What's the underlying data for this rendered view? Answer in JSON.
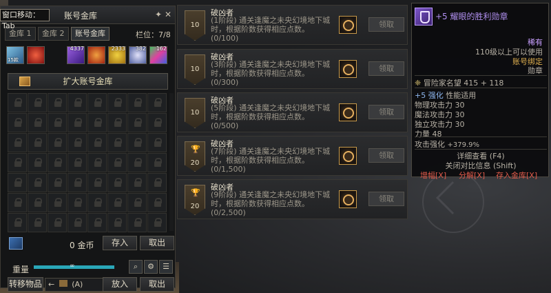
{
  "vault": {
    "title": "账号金库",
    "move_hint": "窗口移动：Tab",
    "tabs": [
      "金库 1",
      "金库 2",
      "账号金库"
    ],
    "slots_label": "栏位：7/8",
    "item_counts": [
      "4337",
      "2333",
      "382",
      "162"
    ],
    "item_badge": "15款",
    "expand_label": "扩大账号金库",
    "gold_amount": "0 金币",
    "deposit_label": "存入",
    "withdraw_label": "取出",
    "weight_label": "重量",
    "weight_value": "∞",
    "transfer_label": "转移物品",
    "transfer_hint": "←",
    "transfer_key": "(A)",
    "put_in_label": "放入",
    "take_out_label": "取出"
  },
  "achievements": [
    {
      "name": "破凶者",
      "desc": "(1阶段) 通关逢魔之未央幻境地下城时，根据阶数获得相应点数。",
      "progress": "(0/100)",
      "badge": "10",
      "trophy": false,
      "claim": "领取"
    },
    {
      "name": "破凶者",
      "desc": "(3阶段) 通关逢魔之未央幻境地下城时，根据阶数获得相应点数。",
      "progress": "(0/300)",
      "badge": "10",
      "trophy": false,
      "claim": "领取"
    },
    {
      "name": "破凶者",
      "desc": "(5阶段) 通关逢魔之未央幻境地下城时，根据阶数获得相应点数。",
      "progress": "(0/500)",
      "badge": "10",
      "trophy": false,
      "claim": "领取"
    },
    {
      "name": "破凶者",
      "desc": "(7阶段) 通关逢魔之未央幻境地下城时，根据阶数获得相应点数。",
      "progress": "(0/1,500)",
      "badge": "20",
      "trophy": true,
      "claim": "领取"
    },
    {
      "name": "破凶者",
      "desc": "(9阶段) 通关逢魔之未央幻境地下城时，根据阶数获得相应点数。",
      "progress": "(0/2,500)",
      "badge": "20",
      "trophy": true,
      "claim": "领取"
    }
  ],
  "tooltip": {
    "name": "+5 耀眼的胜利勋章",
    "rarity": "稀有",
    "level_req": "110级以上可以使用",
    "bind": "账号绑定",
    "type": "勋章",
    "rep_label": "冒险家名望",
    "rep_value": "415 + 118",
    "enhance_prefix": "+5",
    "enhance_label": "强化",
    "enhance_suffix": "性能适用",
    "stats": [
      {
        "label": "物理攻击力",
        "value": "30"
      },
      {
        "label": "魔法攻击力",
        "value": "30"
      },
      {
        "label": "独立攻击力",
        "value": "30"
      },
      {
        "label": "力量",
        "value": "48"
      }
    ],
    "attack_boost_label": "攻击强化",
    "attack_boost_value": "+379.9%",
    "detail_view": "详细查看 (F4)",
    "compare_close": "关闭对比信息 (Shift)",
    "actions": [
      "增幅[X]",
      "分解[X]",
      "存入金库[X]"
    ]
  }
}
